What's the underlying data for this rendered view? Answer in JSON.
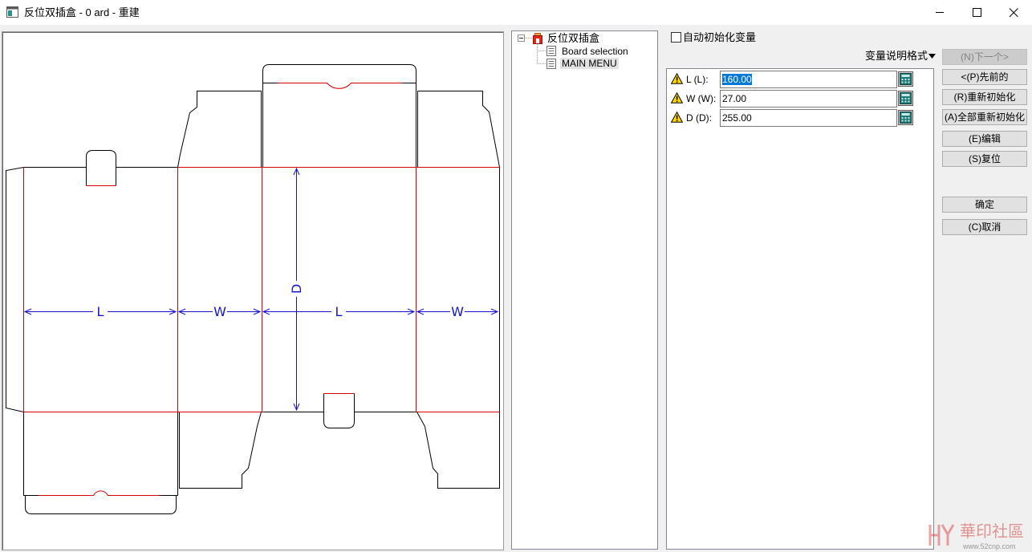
{
  "window": {
    "title": "反位双插盒 - 0 ard - 重建",
    "icon": "app-window-icon",
    "minimize_icon": "minimize-icon",
    "maximize_icon": "maximize-icon",
    "close_icon": "close-icon"
  },
  "drawing": {
    "labels": {
      "panel_1": "L",
      "panel_2": "W",
      "panel_3": "L",
      "panel_4": "W",
      "depth": "D"
    },
    "colors": {
      "cut_line": "#000000",
      "fold_line": "#d40000",
      "dimension": "#1414d2",
      "background": "#ffffff"
    }
  },
  "tree": {
    "root": {
      "label": "反位双插盒",
      "icon": "box-template-icon",
      "expanded": true
    },
    "children": [
      {
        "label": "Board selection",
        "icon": "document-icon",
        "selected": false
      },
      {
        "label": "MAIN MENU",
        "icon": "document-icon",
        "selected": true
      }
    ]
  },
  "options": {
    "auto_init": {
      "label": "自动初始化变量",
      "checked": false
    },
    "format_dropdown": {
      "label": "变量说明格式",
      "icon": "triangle-down-icon"
    }
  },
  "variables": [
    {
      "label": "L (L):",
      "value": "160.00",
      "status_icon": "warning-icon",
      "action_icon": "calculator-icon",
      "selected": true
    },
    {
      "label": "W (W):",
      "value": "27.00",
      "status_icon": "warning-icon",
      "action_icon": "calculator-icon",
      "selected": false
    },
    {
      "label": "D (D):",
      "value": "255.00",
      "status_icon": "warning-icon",
      "action_icon": "calculator-icon",
      "selected": false
    }
  ],
  "buttons": {
    "next": {
      "label": "(N)下一个>",
      "enabled": false
    },
    "previous": {
      "label": "<(P)先前的",
      "enabled": true
    },
    "reinitialize": {
      "label": "(R)重新初始化",
      "enabled": true
    },
    "reinitialize_all": {
      "label": "(A)全部重新初始化",
      "enabled": true
    },
    "edit": {
      "label": "(E)编辑",
      "enabled": true
    },
    "reset": {
      "label": "(S)复位",
      "enabled": true
    },
    "ok": {
      "label": "确定",
      "enabled": true
    },
    "cancel": {
      "label": "(C)取消",
      "enabled": true
    }
  },
  "watermark": {
    "name": "華印社區",
    "site": "www.52cnp.com",
    "icon": "watermark-logo-icon"
  }
}
